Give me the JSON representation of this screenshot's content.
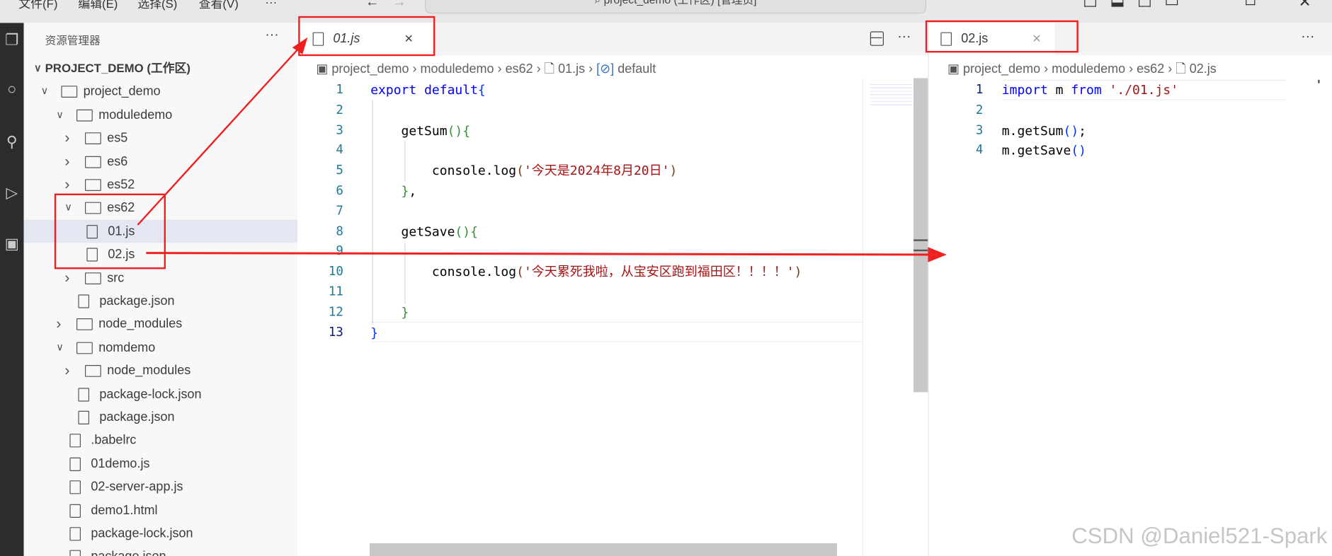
{
  "titlebar": {
    "menus": [
      "文件(F)",
      "编辑(E)",
      "选择(S)",
      "查看(V)",
      "···"
    ],
    "search": "project_demo (工作区) [管理员]"
  },
  "sidebar": {
    "title": "资源管理器",
    "more": "···",
    "tree": [
      {
        "label": "PROJECT_DEMO (工作区)",
        "depth": 0,
        "kind": "root",
        "open": true
      },
      {
        "label": "project_demo",
        "depth": 1,
        "kind": "workspace",
        "open": true
      },
      {
        "label": "moduledemo",
        "depth": 2,
        "kind": "folder",
        "open": true
      },
      {
        "label": "es5",
        "depth": 3,
        "kind": "folder",
        "open": false
      },
      {
        "label": "es6",
        "depth": 3,
        "kind": "folder",
        "open": false
      },
      {
        "label": "es52",
        "depth": 3,
        "kind": "folder",
        "open": false
      },
      {
        "label": "es62",
        "depth": 3,
        "kind": "folder",
        "open": true
      },
      {
        "label": "01.js",
        "depth": 4,
        "kind": "file",
        "selected": true
      },
      {
        "label": "02.js",
        "depth": 4,
        "kind": "file"
      },
      {
        "label": "src",
        "depth": 3,
        "kind": "folder",
        "open": false
      },
      {
        "label": "package.json",
        "depth": 3,
        "kind": "file"
      },
      {
        "label": "node_modules",
        "depth": 2,
        "kind": "folder",
        "open": false
      },
      {
        "label": "nomdemo",
        "depth": 2,
        "kind": "folder",
        "open": true
      },
      {
        "label": "node_modules",
        "depth": 3,
        "kind": "folder",
        "open": false
      },
      {
        "label": "package-lock.json",
        "depth": 3,
        "kind": "file"
      },
      {
        "label": "package.json",
        "depth": 3,
        "kind": "file"
      },
      {
        "label": ".babelrc",
        "depth": 2,
        "kind": "file"
      },
      {
        "label": "01demo.js",
        "depth": 2,
        "kind": "file"
      },
      {
        "label": "02-server-app.js",
        "depth": 2,
        "kind": "file"
      },
      {
        "label": "demo1.html",
        "depth": 2,
        "kind": "file"
      },
      {
        "label": "package-lock.json",
        "depth": 2,
        "kind": "file"
      },
      {
        "label": "package.json",
        "depth": 2,
        "kind": "file"
      }
    ]
  },
  "editor1": {
    "tab": "01.js",
    "close": "×",
    "more": "···",
    "breadcrumb": [
      "project_demo",
      "moduledemo",
      "es62",
      "01.js",
      "default"
    ],
    "lines": [
      [
        [
          "kw",
          "export "
        ],
        [
          "kw",
          "default"
        ],
        [
          "b1",
          "{"
        ]
      ],
      [],
      [
        [
          "id",
          "    getSum"
        ],
        [
          "b2",
          "(){"
        ]
      ],
      [],
      [
        [
          "id",
          "        console.log"
        ],
        [
          "b3",
          "("
        ],
        [
          "str",
          "'今天是2024年8月20日'"
        ],
        [
          "b3",
          ")"
        ]
      ],
      [
        [
          "b2",
          "    }"
        ],
        [
          "id",
          ","
        ]
      ],
      [],
      [
        [
          "id",
          "    getSave"
        ],
        [
          "b2",
          "(){"
        ]
      ],
      [],
      [
        [
          "id",
          "        console.log"
        ],
        [
          "b3",
          "("
        ],
        [
          "str",
          "'今天累死我啦，从宝安区跑到福田区！！！！'"
        ],
        [
          "b3",
          ")"
        ]
      ],
      [],
      [
        [
          "b2",
          "    }"
        ]
      ],
      [
        [
          "b1",
          "}"
        ]
      ]
    ]
  },
  "editor2": {
    "tab": "02.js",
    "close": "×",
    "more": "···",
    "breadcrumb": [
      "project_demo",
      "moduledemo",
      "es62",
      "02.js"
    ],
    "lines": [
      [
        [
          "kw",
          "import "
        ],
        [
          "id",
          "m "
        ],
        [
          "kw",
          "from "
        ],
        [
          "str",
          "'./01.js'"
        ]
      ],
      [],
      [
        [
          "id",
          "m.getSum"
        ],
        [
          "b1",
          "()"
        ],
        [
          "id",
          ";"
        ]
      ],
      [
        [
          "id",
          "m.getSave"
        ],
        [
          "b1",
          "()"
        ]
      ]
    ]
  },
  "annotation_color": "#f02020",
  "watermark": "CSDN @Daniel521-Spark"
}
